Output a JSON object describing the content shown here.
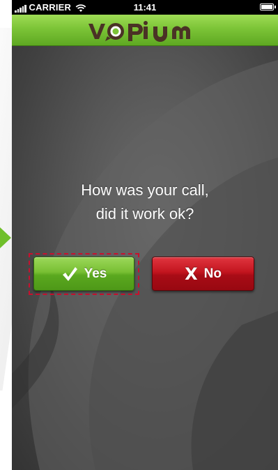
{
  "status_bar": {
    "carrier": "CARRIER",
    "time": "11:41",
    "signal_icon": "signal-bars-icon",
    "wifi_icon": "wifi-icon",
    "battery_icon": "battery-icon"
  },
  "header": {
    "logo_text": "vopium",
    "logo_icon": "vopium-logo",
    "color": "#7cc437"
  },
  "question": {
    "line1": "How was your call,",
    "line2": "did it work ok?"
  },
  "buttons": {
    "yes": {
      "label": "Yes",
      "icon": "checkmark-icon",
      "color": "#78bf33"
    },
    "no": {
      "label": "No",
      "icon_glyph": "X",
      "icon": "x-icon",
      "color": "#c3151f"
    }
  },
  "annotations": {
    "highlight_color": "#c8102e",
    "pointer_color": "#6fbf2a"
  }
}
